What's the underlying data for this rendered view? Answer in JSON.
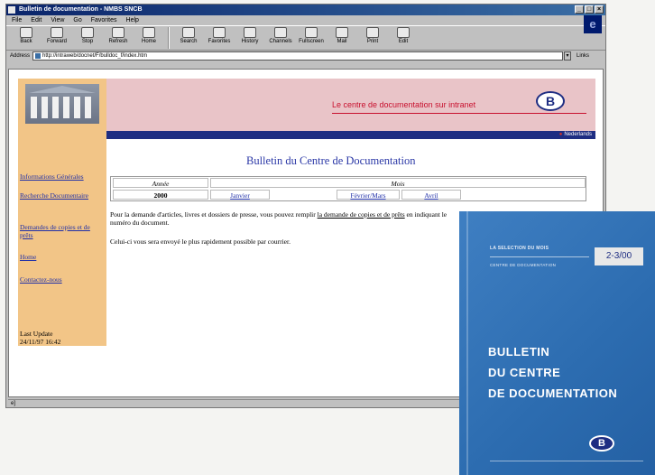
{
  "window": {
    "title": "Bulletin de documentation - NMBS SNCB",
    "min_label": "_",
    "max_label": "□",
    "close_label": "×",
    "ie_logo": "e"
  },
  "menu": [
    "File",
    "Edit",
    "View",
    "Go",
    "Favorites",
    "Help"
  ],
  "toolbar": [
    {
      "label": "Back",
      "icon": "back-arrow-icon"
    },
    {
      "label": "Forward",
      "icon": "forward-arrow-icon"
    },
    {
      "label": "Stop",
      "icon": "stop-icon"
    },
    {
      "label": "Refresh",
      "icon": "refresh-icon"
    },
    {
      "label": "Home",
      "icon": "home-icon"
    },
    {
      "label": "Search",
      "icon": "search-icon"
    },
    {
      "label": "Favorites",
      "icon": "favorites-icon"
    },
    {
      "label": "History",
      "icon": "history-icon"
    },
    {
      "label": "Channels",
      "icon": "channels-icon"
    },
    {
      "label": "Fullscreen",
      "icon": "fullscreen-icon"
    },
    {
      "label": "Mail",
      "icon": "mail-icon"
    },
    {
      "label": "Print",
      "icon": "print-icon"
    },
    {
      "label": "Edit",
      "icon": "edit-icon"
    }
  ],
  "address": {
    "label": "Address",
    "url": "http://intraweb/docnet/F/bulldoc_f/index.htm",
    "links_label": "Links",
    "dropdown_label": "▾"
  },
  "status": {
    "text": "e]"
  },
  "site": {
    "banner_title": "Le centre de documentation sur intranet",
    "logo_letter": "B",
    "lang_link": "Nederlands",
    "page_title": "Bulletin du Centre de Documentation",
    "nav": [
      "Informations Générales",
      "Recherche Documentaire",
      "Demandes de copies et de prêts",
      "Home",
      "Contactez-nous"
    ],
    "last_update_label": "Last Update",
    "last_update_value": "24/11/97 16:42",
    "table": {
      "col_year": "Année",
      "col_month": "Mois",
      "year": "2000",
      "months": [
        "Janvier",
        "Février/Mars",
        "Avril"
      ]
    },
    "para1_before": "Pour la demande d'articles, livres et dossiers de presse, vous pouvez remplir ",
    "para1_link": "la demande de copies et de prêts",
    "para1_after": " en indiquant le",
    "para1_line2": "numéro du document.",
    "para2": "Celui-ci vous sera envoyé le plus rapidement possible par courrier."
  },
  "brochure": {
    "selection": "LA SELECTION DU MOIS",
    "centre": "CENTRE DE DOCUMENTATION",
    "issue": "2-3/00",
    "title_lines": [
      "BULLETIN",
      "DU CENTRE",
      "DE DOCUMENTATION"
    ],
    "logo_letter": "B"
  }
}
